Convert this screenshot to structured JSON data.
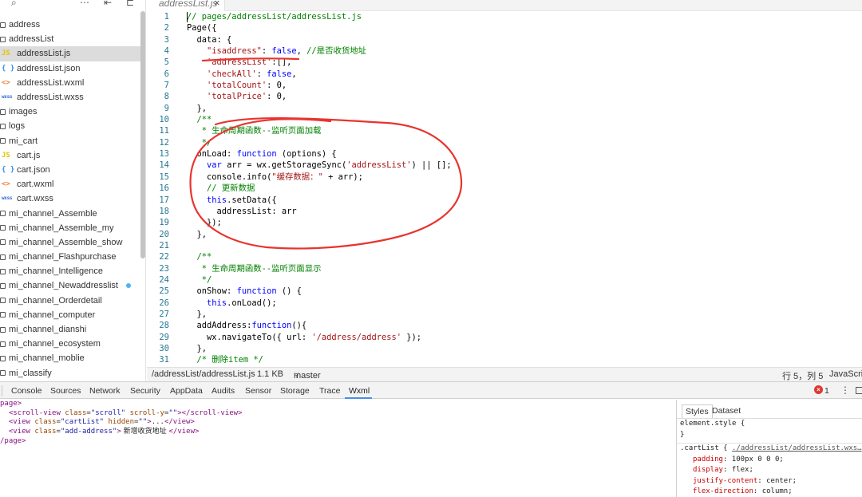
{
  "sidebar": {
    "toolbar": {
      "search_icon": "⌕",
      "more_icon": "⋯",
      "collapse_icon": "⇤",
      "split_icon": "⊏"
    },
    "tree": [
      {
        "label": "address",
        "type": "folder",
        "child": false
      },
      {
        "label": "addressList",
        "type": "folder",
        "child": false
      },
      {
        "label": "addressList.js",
        "type": "js",
        "child": true,
        "selected": true
      },
      {
        "label": "addressList.json",
        "type": "json",
        "child": true
      },
      {
        "label": "addressList.wxml",
        "type": "wxml",
        "child": true
      },
      {
        "label": "addressList.wxss",
        "type": "wxss",
        "child": true
      },
      {
        "label": "images",
        "type": "folder",
        "child": false
      },
      {
        "label": "logs",
        "type": "folder",
        "child": false
      },
      {
        "label": "mi_cart",
        "type": "folder",
        "child": false
      },
      {
        "label": "cart.js",
        "type": "js",
        "child": true
      },
      {
        "label": "cart.json",
        "type": "json",
        "child": true
      },
      {
        "label": "cart.wxml",
        "type": "wxml",
        "child": true
      },
      {
        "label": "cart.wxss",
        "type": "wxss",
        "child": true
      },
      {
        "label": "mi_channel_Assemble",
        "type": "folder",
        "child": false
      },
      {
        "label": "mi_channel_Assemble_my",
        "type": "folder",
        "child": false
      },
      {
        "label": "mi_channel_Assemble_show",
        "type": "folder",
        "child": false
      },
      {
        "label": "mi_channel_Flashpurchase",
        "type": "folder",
        "child": false
      },
      {
        "label": "mi_channel_Intelligence",
        "type": "folder",
        "child": false
      },
      {
        "label": "mi_channel_Newaddresslist",
        "type": "folder",
        "child": false,
        "modified": true
      },
      {
        "label": "mi_channel_Orderdetail",
        "type": "folder",
        "child": false
      },
      {
        "label": "mi_channel_computer",
        "type": "folder",
        "child": false
      },
      {
        "label": "mi_channel_dianshi",
        "type": "folder",
        "child": false
      },
      {
        "label": "mi_channel_ecosystem",
        "type": "folder",
        "child": false
      },
      {
        "label": "mi_channel_moblie",
        "type": "folder",
        "child": false
      },
      {
        "label": "mi_classify",
        "type": "folder",
        "child": false
      }
    ],
    "icon_glyphs": {
      "js": "JS",
      "json": "{ }",
      "wxml": "<>",
      "wxss": "wxss"
    }
  },
  "editor": {
    "tab_label": "addressList.js",
    "tab_close": "×",
    "lines": [
      [
        [
          "comment",
          "// pages/addressList/addressList.js"
        ]
      ],
      [
        [
          "plain",
          "Page({"
        ]
      ],
      [
        [
          "plain",
          "  data: {"
        ]
      ],
      [
        [
          "plain",
          "    "
        ],
        [
          "string",
          "\"isaddress\""
        ],
        [
          "plain",
          ": "
        ],
        [
          "keyword",
          "false"
        ],
        [
          "plain",
          ", "
        ],
        [
          "comment",
          "//是否收货地址"
        ]
      ],
      [
        [
          "plain",
          "    "
        ],
        [
          "string",
          "'addressList'"
        ],
        [
          "plain",
          ":[],"
        ]
      ],
      [
        [
          "plain",
          "    "
        ],
        [
          "string",
          "'checkAll'"
        ],
        [
          "plain",
          ": "
        ],
        [
          "keyword",
          "false"
        ],
        [
          "plain",
          ","
        ]
      ],
      [
        [
          "plain",
          "    "
        ],
        [
          "string",
          "'totalCount'"
        ],
        [
          "plain",
          ": 0,"
        ]
      ],
      [
        [
          "plain",
          "    "
        ],
        [
          "string",
          "'totalPrice'"
        ],
        [
          "plain",
          ": 0,"
        ]
      ],
      [
        [
          "plain",
          "  },"
        ]
      ],
      [
        [
          "comment",
          "  /**"
        ]
      ],
      [
        [
          "comment",
          "   * 生命周期函数--监听页面加载"
        ]
      ],
      [
        [
          "comment",
          "   */"
        ]
      ],
      [
        [
          "plain",
          "  onLoad: "
        ],
        [
          "keyword",
          "function"
        ],
        [
          "plain",
          " (options) {"
        ]
      ],
      [
        [
          "plain",
          "    "
        ],
        [
          "keyword",
          "var"
        ],
        [
          "plain",
          " arr = wx.getStorageSync("
        ],
        [
          "string",
          "'addressList'"
        ],
        [
          "plain",
          ") || [];"
        ]
      ],
      [
        [
          "plain",
          "    console.info("
        ],
        [
          "string",
          "\"缓存数据：\""
        ],
        [
          "plain",
          " + arr);"
        ]
      ],
      [
        [
          "comment",
          "    // 更新数据"
        ]
      ],
      [
        [
          "plain",
          "    "
        ],
        [
          "keyword",
          "this"
        ],
        [
          "plain",
          ".setData({"
        ]
      ],
      [
        [
          "plain",
          "      addressList: arr"
        ]
      ],
      [
        [
          "plain",
          "    });"
        ]
      ],
      [
        [
          "plain",
          "  },"
        ]
      ],
      [
        [
          "plain",
          ""
        ]
      ],
      [
        [
          "comment",
          "  /**"
        ]
      ],
      [
        [
          "comment",
          "   * 生命周期函数--监听页面显示"
        ]
      ],
      [
        [
          "comment",
          "   */"
        ]
      ],
      [
        [
          "plain",
          "  onShow: "
        ],
        [
          "keyword",
          "function"
        ],
        [
          "plain",
          " () {"
        ]
      ],
      [
        [
          "plain",
          "    "
        ],
        [
          "keyword",
          "this"
        ],
        [
          "plain",
          ".onLoad();"
        ]
      ],
      [
        [
          "plain",
          "  },"
        ]
      ],
      [
        [
          "plain",
          "  addAddress:"
        ],
        [
          "keyword",
          "function"
        ],
        [
          "plain",
          "(){"
        ]
      ],
      [
        [
          "plain",
          "    wx.navigateTo({ url: "
        ],
        [
          "string",
          "'/address/address'"
        ],
        [
          "plain",
          " });"
        ]
      ],
      [
        [
          "plain",
          "  },"
        ]
      ],
      [
        [
          "comment",
          "  /* 删除item */"
        ]
      ]
    ],
    "annotation_color": "#e8342e"
  },
  "statusbar": {
    "path": "/addressList/addressList.js",
    "size": "1.1 KB",
    "branch": "master",
    "branch_icon": "⑂",
    "position": "行 5，列 5",
    "language": "JavaScript"
  },
  "devtools": {
    "tabs": [
      "Console",
      "Sources",
      "Network",
      "Security",
      "AppData",
      "Audits",
      "Sensor",
      "Storage",
      "Trace",
      "Wxml"
    ],
    "active_tab": "Wxml",
    "error_count": "1",
    "error_glyph": "×",
    "kebab": "⋮",
    "wxml_lines": [
      [
        [
          "tag",
          "page>"
        ]
      ],
      [
        [
          "plain",
          "  "
        ],
        [
          "tag",
          "<scroll-view"
        ],
        [
          "plain",
          " "
        ],
        [
          "attr",
          "class"
        ],
        [
          "plain",
          "="
        ],
        [
          "val",
          "\"scroll\""
        ],
        [
          "plain",
          " "
        ],
        [
          "attr",
          "scroll-y"
        ],
        [
          "plain",
          "="
        ],
        [
          "val",
          "\"\""
        ],
        [
          "tag",
          "></scroll-view>"
        ]
      ],
      [
        [
          "plain",
          "  "
        ],
        [
          "tag",
          "<view"
        ],
        [
          "plain",
          " "
        ],
        [
          "attr",
          "class"
        ],
        [
          "plain",
          "="
        ],
        [
          "val",
          "\"cartList\""
        ],
        [
          "plain",
          " "
        ],
        [
          "attr",
          "hidden"
        ],
        [
          "plain",
          "="
        ],
        [
          "val",
          "\"\""
        ],
        [
          "tag",
          ">"
        ],
        [
          "plain",
          "..."
        ],
        [
          "tag",
          "</view>"
        ]
      ],
      [
        [
          "plain",
          "  "
        ],
        [
          "tag",
          "<view"
        ],
        [
          "plain",
          " "
        ],
        [
          "attr",
          "class"
        ],
        [
          "plain",
          "="
        ],
        [
          "val",
          "\"add-address\""
        ],
        [
          "tag",
          ">"
        ],
        [
          "txt",
          " 新增收货地址 "
        ],
        [
          "tag",
          "</view>"
        ]
      ],
      [
        [
          "tag",
          "/page>"
        ]
      ]
    ],
    "styles": {
      "tabs": [
        "Styles",
        "Dataset"
      ],
      "element_style_open": "element.style {",
      "element_style_close": "}",
      "rule_selector": ".cartList {",
      "rule_source": "./addressList/addressList.wxs…",
      "props": [
        {
          "key": "padding",
          "value": "100px 0 0 0;"
        },
        {
          "key": "display",
          "value": "flex;"
        },
        {
          "key": "justify-content",
          "value": "center;"
        },
        {
          "key": "flex-direction",
          "value": "column;"
        }
      ]
    }
  }
}
